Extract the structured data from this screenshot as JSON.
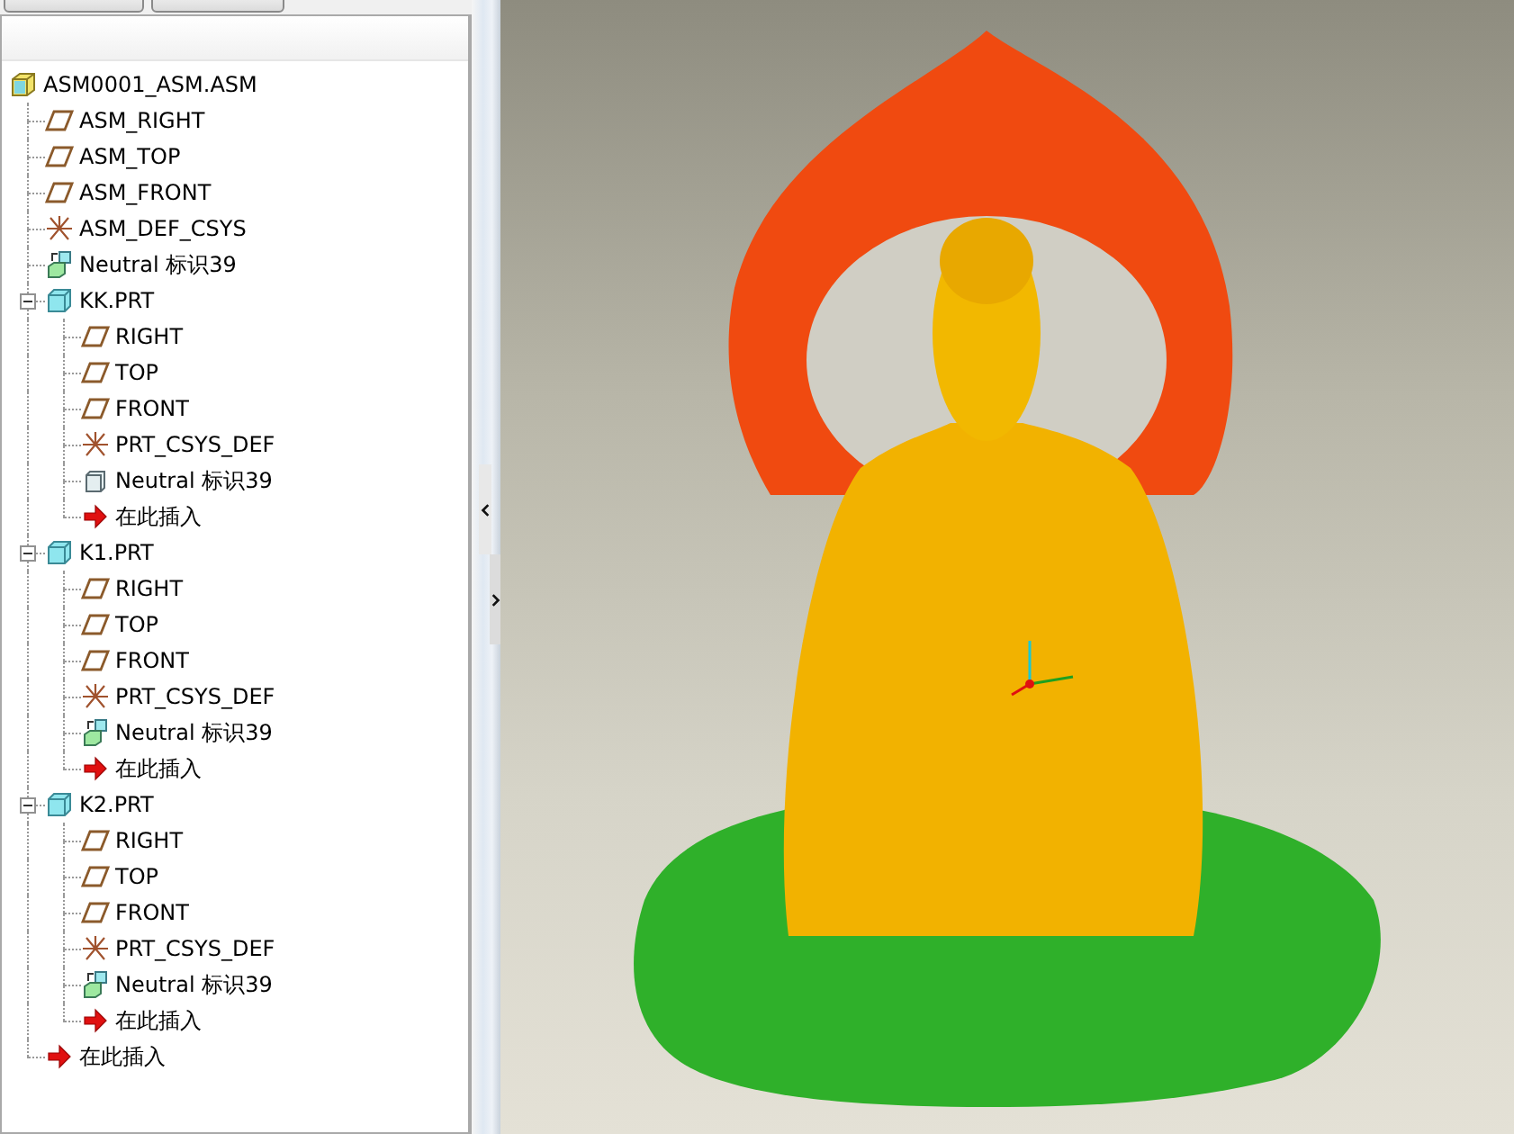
{
  "model_tree": {
    "items": [
      {
        "label": "ASM0001_ASM.ASM",
        "kind": "assembly",
        "children": [
          {
            "label": "ASM_RIGHT",
            "kind": "plane"
          },
          {
            "label": "ASM_TOP",
            "kind": "plane"
          },
          {
            "label": "ASM_FRONT",
            "kind": "plane"
          },
          {
            "label": "ASM_DEF_CSYS",
            "kind": "csys"
          },
          {
            "label": "Neutral 标识39",
            "kind": "import"
          },
          {
            "label": "KK.PRT",
            "kind": "part",
            "expanded": true,
            "children": [
              {
                "label": "RIGHT",
                "kind": "plane"
              },
              {
                "label": "TOP",
                "kind": "plane"
              },
              {
                "label": "FRONT",
                "kind": "plane"
              },
              {
                "label": "PRT_CSYS_DEF",
                "kind": "csys"
              },
              {
                "label": "Neutral 标识39",
                "kind": "body"
              },
              {
                "label": "在此插入",
                "kind": "insert"
              }
            ]
          },
          {
            "label": "K1.PRT",
            "kind": "part",
            "expanded": true,
            "children": [
              {
                "label": "RIGHT",
                "kind": "plane"
              },
              {
                "label": "TOP",
                "kind": "plane"
              },
              {
                "label": "FRONT",
                "kind": "plane"
              },
              {
                "label": "PRT_CSYS_DEF",
                "kind": "csys"
              },
              {
                "label": "Neutral 标识39",
                "kind": "import"
              },
              {
                "label": "在此插入",
                "kind": "insert"
              }
            ]
          },
          {
            "label": "K2.PRT",
            "kind": "part",
            "expanded": true,
            "children": [
              {
                "label": "RIGHT",
                "kind": "plane"
              },
              {
                "label": "TOP",
                "kind": "plane"
              },
              {
                "label": "FRONT",
                "kind": "plane"
              },
              {
                "label": "PRT_CSYS_DEF",
                "kind": "csys"
              },
              {
                "label": "Neutral 标识39",
                "kind": "import"
              },
              {
                "label": "在此插入",
                "kind": "insert"
              }
            ]
          },
          {
            "label": "在此插入",
            "kind": "insert"
          }
        ]
      }
    ]
  }
}
